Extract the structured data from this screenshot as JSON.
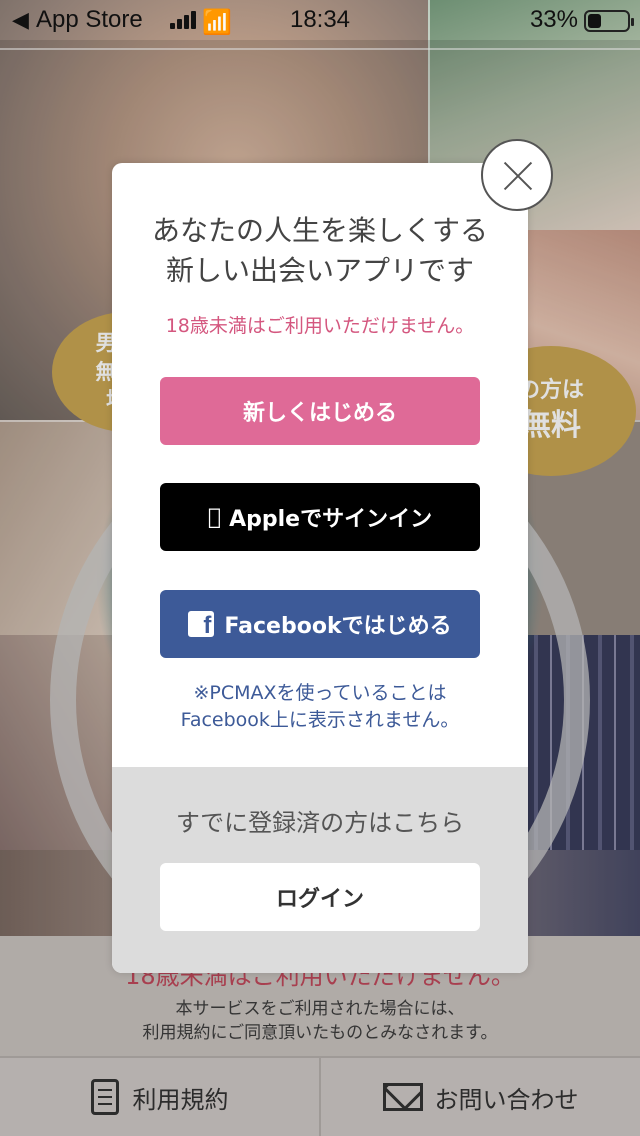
{
  "status_bar": {
    "back_label": "App Store",
    "time": "18:34",
    "battery_percent": "33%",
    "battery_level": 0.33
  },
  "background": {
    "badge_left": [
      "男性の",
      "無料ポ",
      "増量"
    ],
    "badge_right": [
      "の方は",
      "無料"
    ],
    "footer_warning": "18歳未満はご利用いただけません。",
    "footer_terms": [
      "本サービスをご利用された場合には、",
      "利用規約にご同意頂いたものとみなされます。"
    ]
  },
  "tabbar": {
    "terms_label": "利用規約",
    "contact_label": "お問い合わせ"
  },
  "modal": {
    "headline": [
      "あなたの人生を楽しくする",
      "新しい出会いアプリです"
    ],
    "age_notice": "18歳未満はご利用いただけません。",
    "new_button": "新しくはじめる",
    "apple_button": "Appleでサインイン",
    "facebook_button": "Facebookではじめる",
    "facebook_note": [
      "※PCMAXを使っていることは",
      "Facebook上に表示されません。"
    ],
    "already_registered": "すでに登録済の方はこちら",
    "login_button": "ログイン"
  },
  "colors": {
    "pink": "#df6a97",
    "facebook_blue": "#3d5a98",
    "age_notice": "#d4577f"
  }
}
